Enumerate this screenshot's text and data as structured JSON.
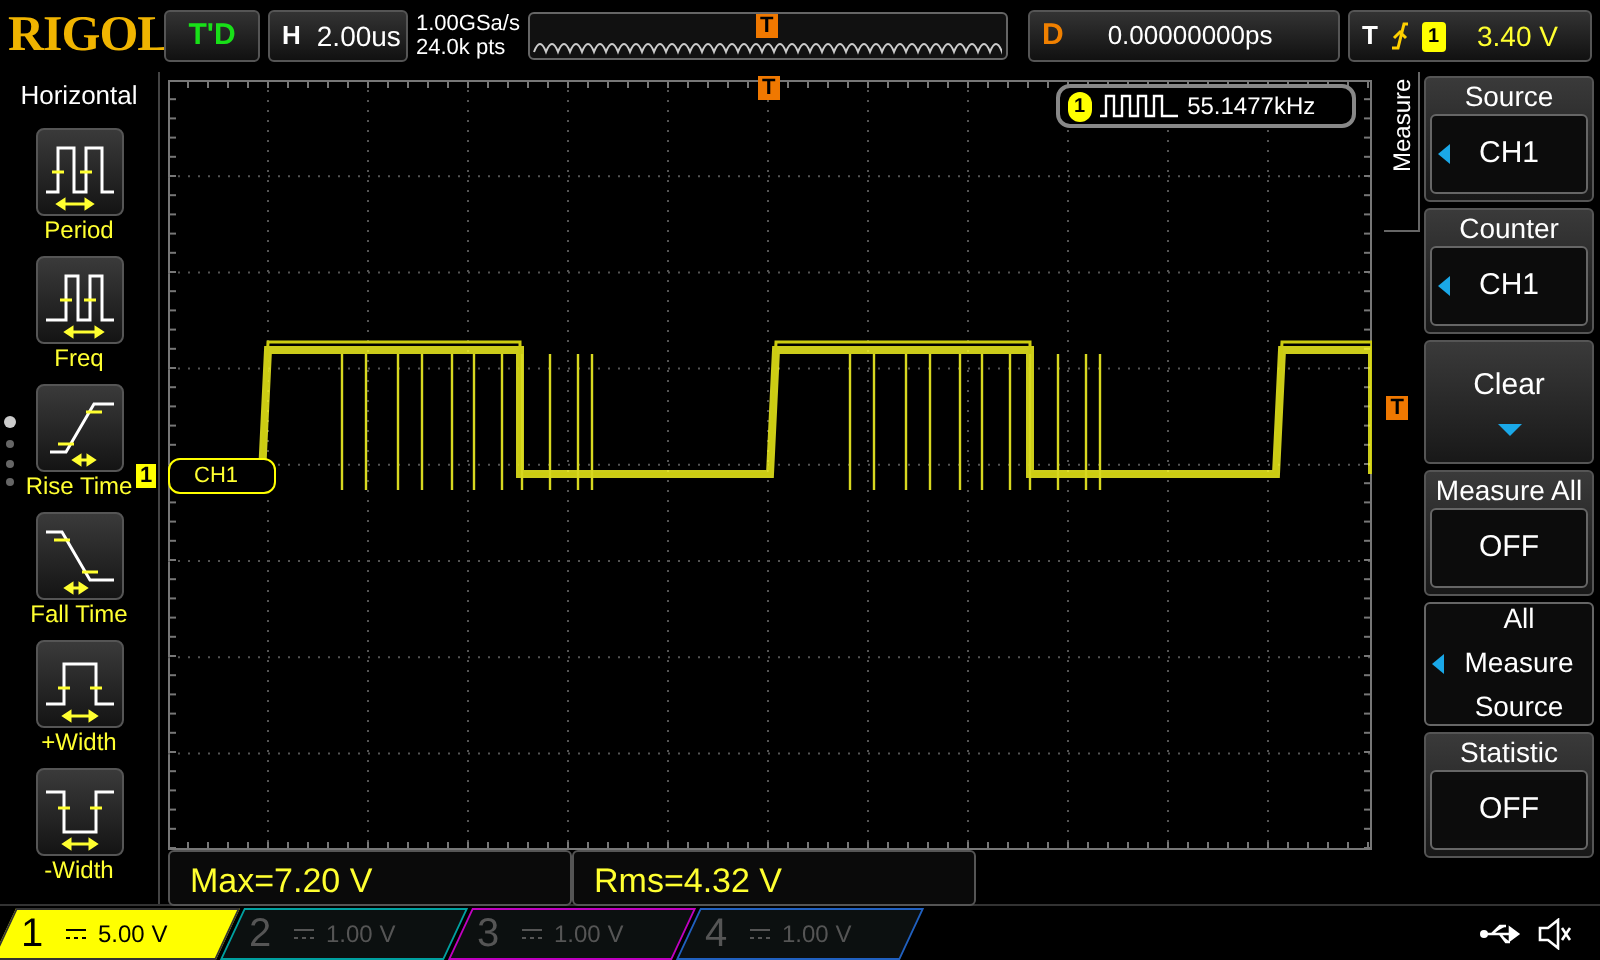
{
  "brand": "RIGOL",
  "run_state": "T'D",
  "timebase": {
    "label": "H",
    "value": "2.00us"
  },
  "sample_rate": "1.00GSa/s",
  "memory_depth": "24.0k pts",
  "overview_trigger_tag": "T",
  "delay": {
    "label": "D",
    "value": "0.00000000ps"
  },
  "trigger": {
    "label": "T",
    "channel": "1",
    "level": "3.40 V"
  },
  "left_menu": {
    "title": "Horizontal",
    "items": [
      {
        "label": "Period",
        "kind": "period"
      },
      {
        "label": "Freq",
        "kind": "freq"
      },
      {
        "label": "Rise Time",
        "kind": "rise"
      },
      {
        "label": "Fall Time",
        "kind": "fall"
      },
      {
        "label": "+Width",
        "kind": "pwidth"
      },
      {
        "label": "-Width",
        "kind": "nwidth"
      }
    ]
  },
  "plot": {
    "channel_tag": "1",
    "channel_label": "CH1",
    "trigger_tag": "T",
    "top_trigger_tag": "T"
  },
  "counter": {
    "channel": "1",
    "value": "55.1477kHz"
  },
  "right_menu": {
    "title": "Measure",
    "items": [
      {
        "label": "Source",
        "value": "CH1",
        "kind": "select"
      },
      {
        "label": "Counter",
        "value": "CH1",
        "kind": "select"
      },
      {
        "label": "Clear",
        "kind": "action"
      },
      {
        "label": "Measure All",
        "value": "OFF",
        "kind": "toggle"
      },
      {
        "label": "All Measure Source",
        "kind": "submenu"
      },
      {
        "label": "Statistic",
        "value": "OFF",
        "kind": "toggle"
      }
    ]
  },
  "measurements": [
    {
      "text": "Max=7.20 V"
    },
    {
      "text": "Rms=4.32 V"
    }
  ],
  "channels": [
    {
      "number": "1",
      "scale": "5.00 V",
      "on": true,
      "color": "#ffff00"
    },
    {
      "number": "2",
      "scale": "1.00 V",
      "on": false,
      "color": "#00a0a0"
    },
    {
      "number": "3",
      "scale": "1.00 V",
      "on": false,
      "color": "#c000c0"
    },
    {
      "number": "4",
      "scale": "1.00 V",
      "on": false,
      "color": "#2060c0"
    }
  ]
}
